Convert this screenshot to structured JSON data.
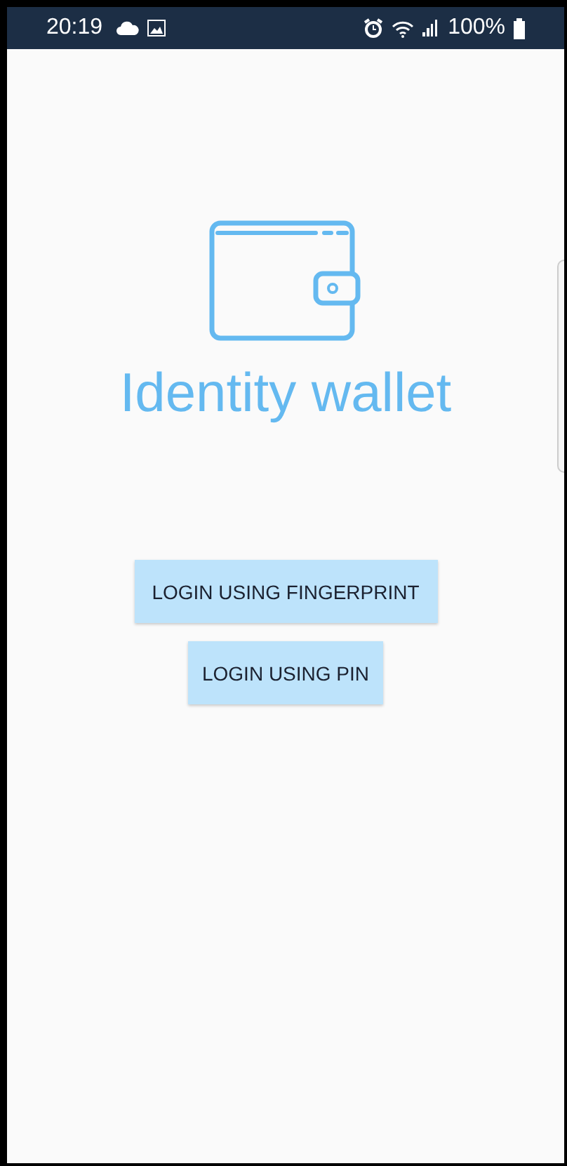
{
  "status_bar": {
    "time": "20:19",
    "battery": "100%"
  },
  "app": {
    "title": "Identity wallet"
  },
  "buttons": [
    {
      "label": "LOGIN USING FINGERPRINT"
    },
    {
      "label": "LOGIN USING PIN"
    }
  ]
}
